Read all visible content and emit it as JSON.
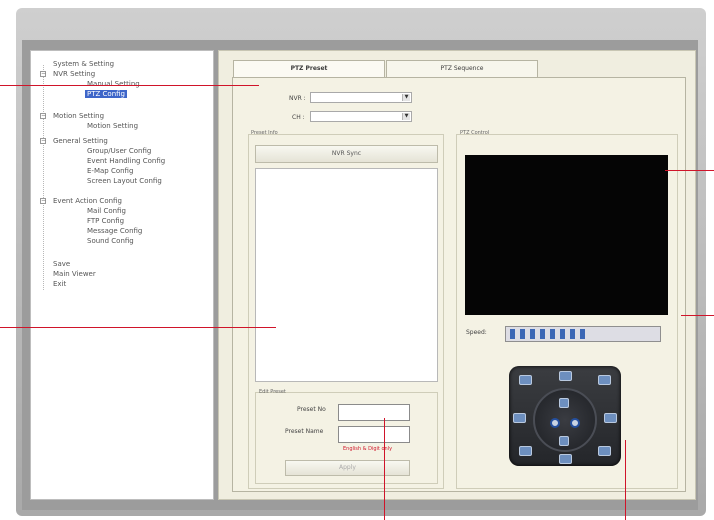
{
  "tree": {
    "items": [
      {
        "label": "System & Setting"
      },
      {
        "label": "NVR Setting"
      },
      {
        "label": "Manual Setting"
      },
      {
        "label": "PTZ Config"
      },
      {
        "label": "Motion Setting"
      },
      {
        "label": "Motion Setting"
      },
      {
        "label": "General Setting"
      },
      {
        "label": "Group/User Config"
      },
      {
        "label": "Event Handling Config"
      },
      {
        "label": "E-Map Config"
      },
      {
        "label": "Screen Layout Config"
      },
      {
        "label": "Event Action Config"
      },
      {
        "label": "Mail Config"
      },
      {
        "label": "FTP Config"
      },
      {
        "label": "Message Config"
      },
      {
        "label": "Sound Config"
      },
      {
        "label": "Save"
      },
      {
        "label": "Main Viewer"
      },
      {
        "label": "Exit"
      }
    ]
  },
  "tabs": [
    {
      "label": "PTZ Preset",
      "active": true
    },
    {
      "label": "PTZ Sequence",
      "active": false
    }
  ],
  "form": {
    "nvr_label": "NVR :",
    "ch_label": "CH :",
    "nvr_value": "",
    "ch_value": ""
  },
  "preset_info": {
    "title": "Preset Info",
    "sync_button": "NVR Sync"
  },
  "edit_preset": {
    "title": "Edit Preset",
    "preset_no_label": "Preset No",
    "preset_name_label": "Preset Name",
    "preset_no_value": "",
    "preset_name_value": "",
    "hint": "English & Digit only",
    "apply_button": "Apply"
  },
  "ptz_control": {
    "title": "PTZ Control",
    "speed_label": "Speed:",
    "speed_level": 0.55
  },
  "colors": {
    "accent": "#d0142a",
    "selection": "#3e66c9",
    "speed_fill": "#3b67b5"
  }
}
